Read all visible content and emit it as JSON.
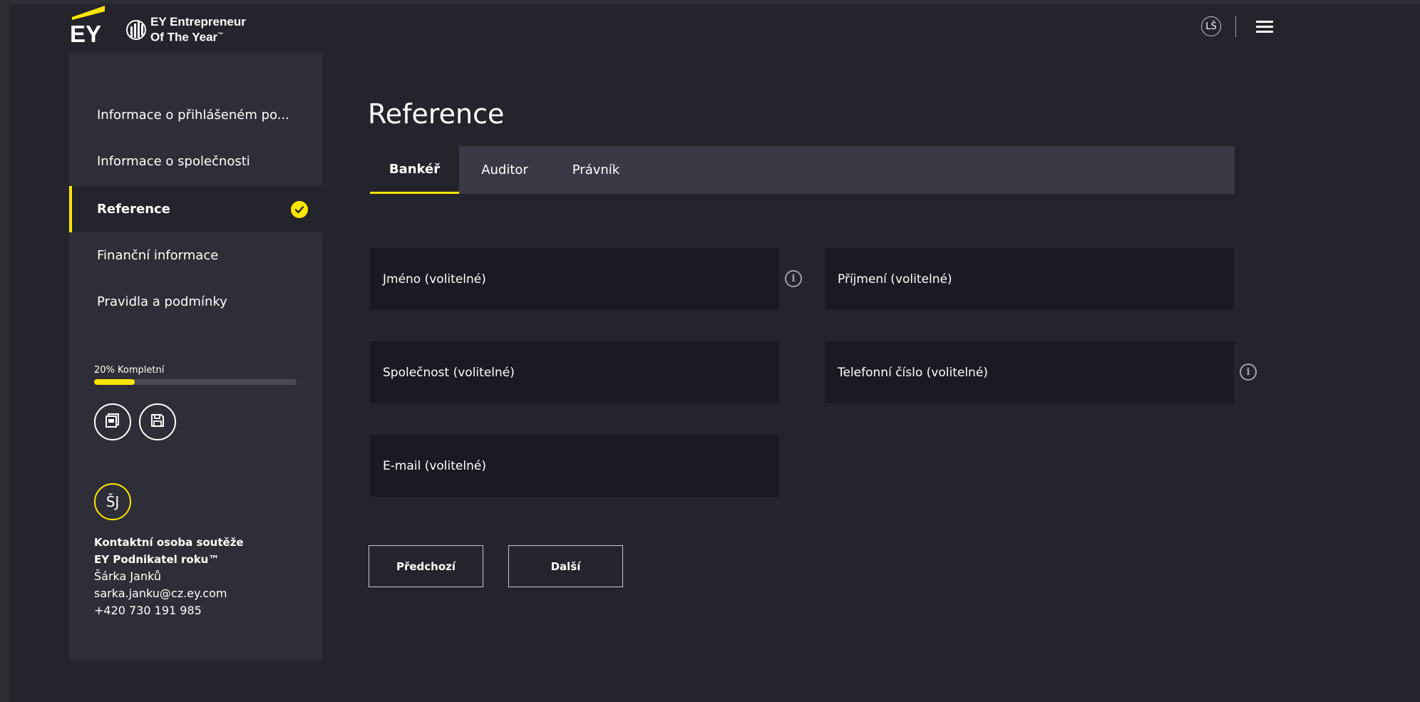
{
  "header": {
    "brand_logo": "EY",
    "program_logo_line1": "EY Entrepreneur",
    "program_logo_line2": "Of The Year",
    "program_logo_tm": "™",
    "user_initials": "LŠ",
    "menu_icon": "hamburger-icon"
  },
  "sidebar": {
    "items": [
      {
        "label": "Informace o přihlášeném po..."
      },
      {
        "label": "Informace o společnosti"
      },
      {
        "label": "Reference",
        "active": true,
        "completed": true
      },
      {
        "label": "Finanční informace"
      },
      {
        "label": "Pravidla a podmínky"
      }
    ],
    "progress": {
      "label": "20% Kompletní",
      "value": 0.2
    },
    "actions": [
      {
        "icon": "pdf-icon"
      },
      {
        "icon": "save-icon"
      }
    ],
    "contact": {
      "initials": "ŠJ",
      "title_line1": "Kontaktní osoba soutěže",
      "title_line2": "EY Podnikatel roku™",
      "name": "Šárka Janků",
      "email": "sarka.janku@cz.ey.com",
      "phone": "+420 730 191 985"
    }
  },
  "main": {
    "title": "Reference",
    "tabs": [
      {
        "label": "Bankéř",
        "active": true
      },
      {
        "label": "Auditor"
      },
      {
        "label": "Právník"
      }
    ],
    "fields": {
      "first_name": "Jméno (volitelné)",
      "last_name": "Příjmení (volitelné)",
      "company": "Společnost (volitelné)",
      "phone": "Telefonní číslo (volitelné)",
      "email": "E-mail (volitelné)"
    },
    "buttons": {
      "previous": "Předchozí",
      "next": "Další"
    }
  },
  "colors": {
    "accent": "#ffe600",
    "background": "#24242d",
    "sidebar": "#2e2e38",
    "field": "#1a1a23",
    "tabbar": "#3a3a47"
  }
}
